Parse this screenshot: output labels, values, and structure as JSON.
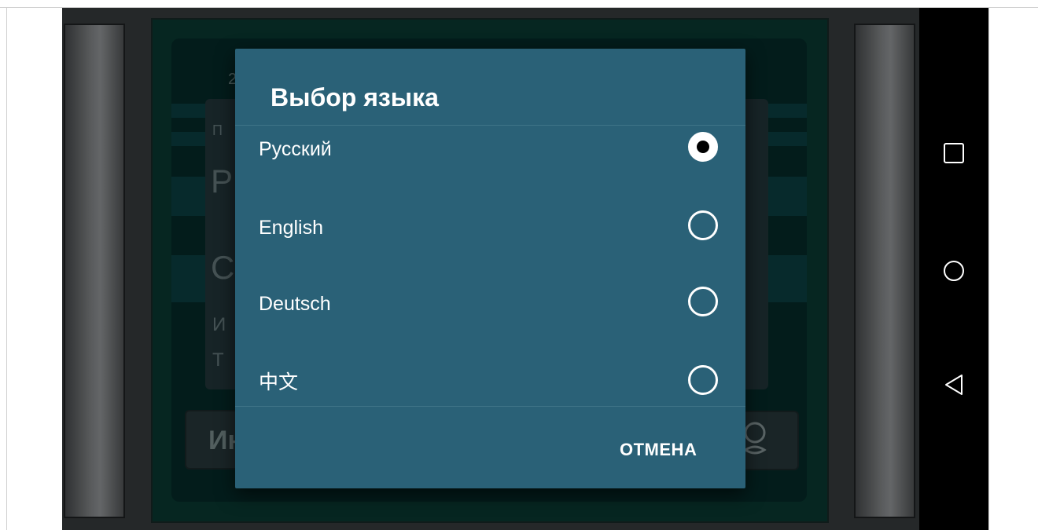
{
  "background": {
    "number_fragment": "2",
    "letter_fragments": [
      "П",
      "Р",
      "С",
      "И",
      "Т"
    ],
    "button_fragment": "Ин"
  },
  "dialog": {
    "title": "Выбор языка",
    "options": [
      {
        "label": "Русский",
        "selected": true
      },
      {
        "label": "English",
        "selected": false
      },
      {
        "label": "Deutsch",
        "selected": false
      },
      {
        "label": "中文",
        "selected": false
      }
    ],
    "cancel_label": "ОТМЕНА"
  },
  "navbar": {
    "icons": [
      "recents-square-icon",
      "home-circle-icon",
      "back-triangle-icon"
    ]
  },
  "colors": {
    "dialog_bg": "#2a6177",
    "board_bg": "#0a3b33",
    "navbar_bg": "#000000"
  }
}
